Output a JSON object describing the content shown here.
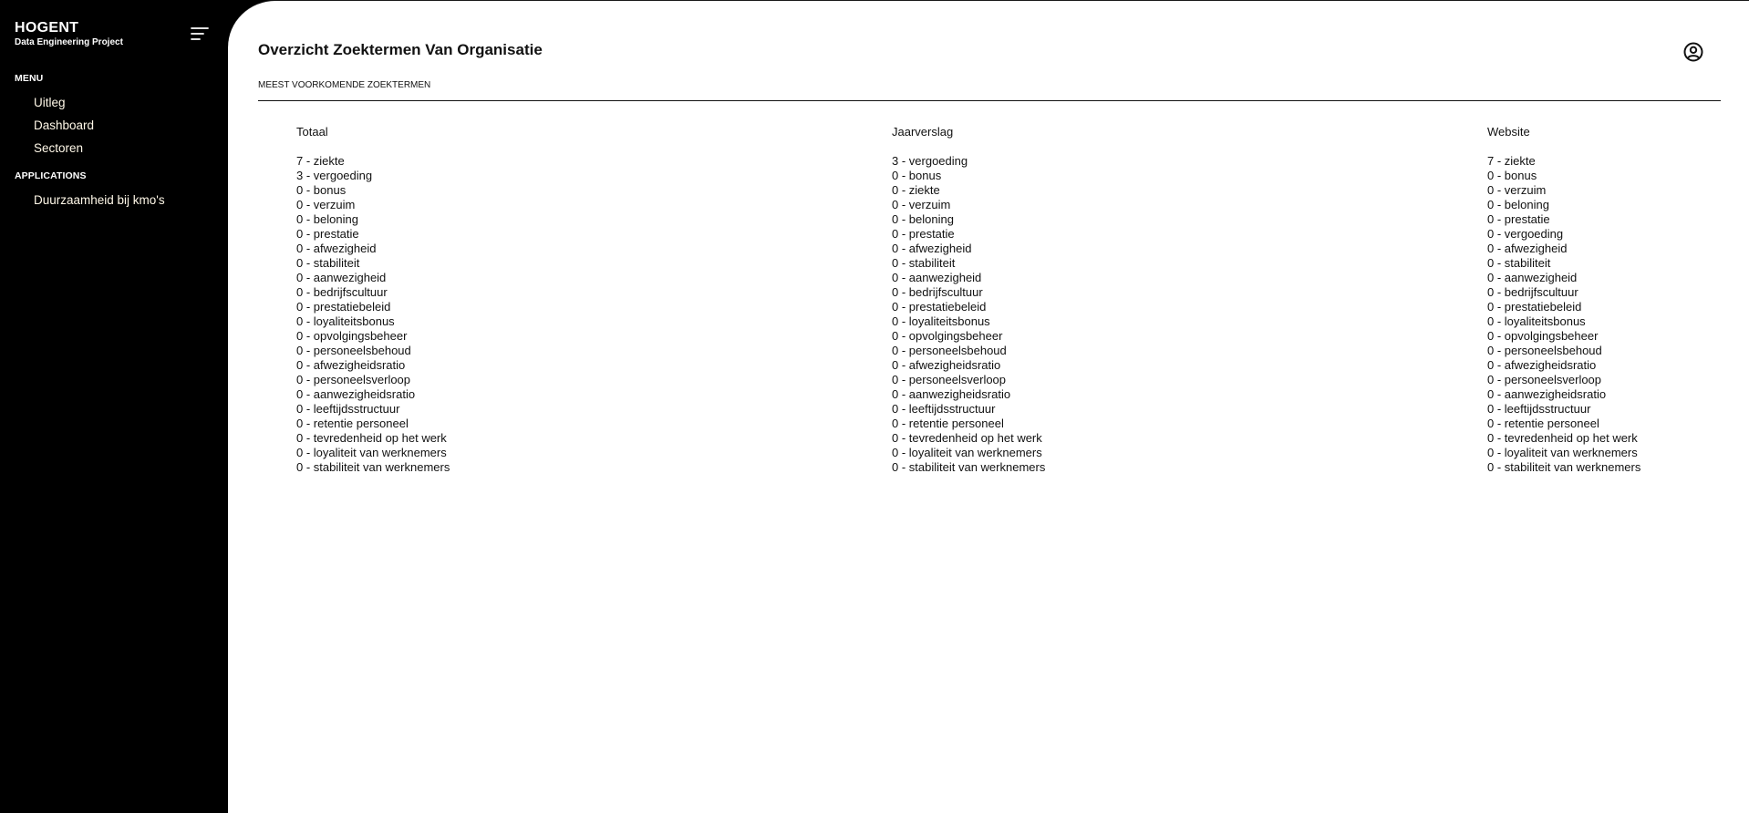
{
  "brand": {
    "title": "HOGENT",
    "subtitle": "Data Engineering Project"
  },
  "sidebar": {
    "menu_label": "MENU",
    "menu_items": [
      {
        "label": "Uitleg"
      },
      {
        "label": "Dashboard"
      },
      {
        "label": "Sectoren"
      }
    ],
    "applications_label": "APPLICATIONS",
    "application_items": [
      {
        "label": "Duurzaamheid bij kmo's"
      }
    ]
  },
  "header": {
    "title": "Overzicht Zoektermen Van Organisatie",
    "subtitle": "MEEST VOORKOMENDE ZOEKTERMEN",
    "user_icon": "user-circle-icon",
    "menu_icon": "hamburger-menu-icon"
  },
  "columns": [
    {
      "title": "Totaal",
      "terms": [
        "7 - ziekte",
        "3 - vergoeding",
        "0 - bonus",
        "0 - verzuim",
        "0 - beloning",
        "0 - prestatie",
        "0 - afwezigheid",
        "0 - stabiliteit",
        "0 - aanwezigheid",
        "0 - bedrijfscultuur",
        "0 - prestatiebeleid",
        "0 - loyaliteitsbonus",
        "0 - opvolgingsbeheer",
        "0 - personeelsbehoud",
        "0 - afwezigheidsratio",
        "0 - personeelsverloop",
        "0 - aanwezigheidsratio",
        "0 - leeftijdsstructuur",
        "0 - retentie personeel",
        "0 - tevredenheid op het werk",
        "0 - loyaliteit van werknemers",
        "0 - stabiliteit van werknemers"
      ]
    },
    {
      "title": "Jaarverslag",
      "terms": [
        "3 - vergoeding",
        "0 - bonus",
        "0 - ziekte",
        "0 - verzuim",
        "0 - beloning",
        "0 - prestatie",
        "0 - afwezigheid",
        "0 - stabiliteit",
        "0 - aanwezigheid",
        "0 - bedrijfscultuur",
        "0 - prestatiebeleid",
        "0 - loyaliteitsbonus",
        "0 - opvolgingsbeheer",
        "0 - personeelsbehoud",
        "0 - afwezigheidsratio",
        "0 - personeelsverloop",
        "0 - aanwezigheidsratio",
        "0 - leeftijdsstructuur",
        "0 - retentie personeel",
        "0 - tevredenheid op het werk",
        "0 - loyaliteit van werknemers",
        "0 - stabiliteit van werknemers"
      ]
    },
    {
      "title": "Website",
      "terms": [
        "7 - ziekte",
        "0 - bonus",
        "0 - verzuim",
        "0 - beloning",
        "0 - prestatie",
        "0 - vergoeding",
        "0 - afwezigheid",
        "0 - stabiliteit",
        "0 - aanwezigheid",
        "0 - bedrijfscultuur",
        "0 - prestatiebeleid",
        "0 - loyaliteitsbonus",
        "0 - opvolgingsbeheer",
        "0 - personeelsbehoud",
        "0 - afwezigheidsratio",
        "0 - personeelsverloop",
        "0 - aanwezigheidsratio",
        "0 - leeftijdsstructuur",
        "0 - retentie personeel",
        "0 - tevredenheid op het werk",
        "0 - loyaliteit van werknemers",
        "0 - stabiliteit van werknemers"
      ]
    }
  ]
}
